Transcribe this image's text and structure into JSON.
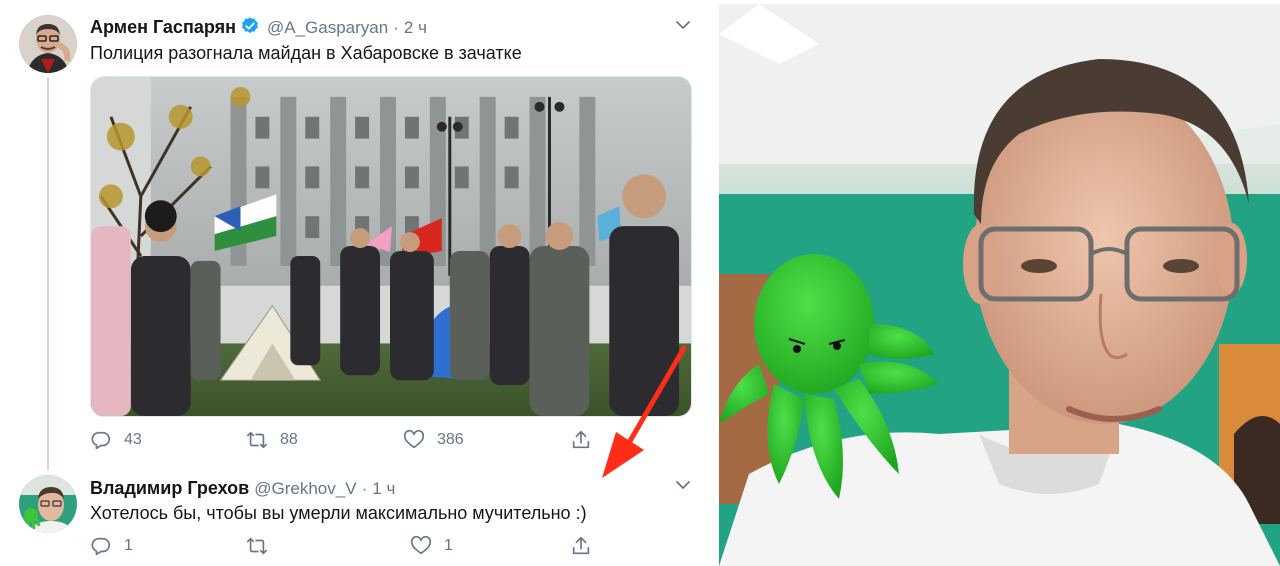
{
  "tweets": [
    {
      "name": "Армен Гаспарян",
      "handle": "@A_Gasparyan",
      "dot": "·",
      "time": "2 ч",
      "text": "Полиция разогнала майдан в Хабаровске в зачатке",
      "verified": true,
      "replies": "43",
      "retweets": "88",
      "likes": "386"
    },
    {
      "name": "Владимир Грехов",
      "handle": "@Grekhov_V",
      "dot": "·",
      "time": "1 ч",
      "text": "Хотелось бы, чтобы вы умерли максимально мучительно :)",
      "verified": false,
      "replies": "1",
      "retweets": "",
      "likes": "1"
    }
  ],
  "icons": {
    "reply": "reply-icon",
    "retweet": "retweet-icon",
    "like": "heart-icon",
    "share": "share-icon",
    "verified": "verified-badge-icon",
    "more": "chevron-down-icon"
  },
  "colors": {
    "accent": "#1da1f2",
    "text": "#14171a",
    "secondary": "#657786",
    "arrow": "#ff2d17"
  }
}
